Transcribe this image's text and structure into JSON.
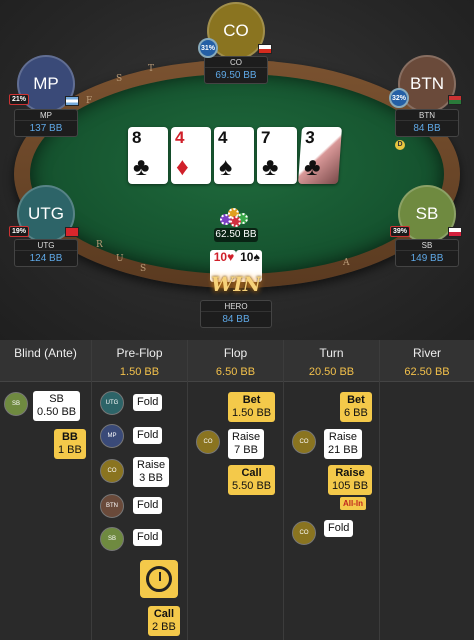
{
  "table": {
    "rail_text": [
      "F",
      "S",
      "T",
      "R",
      "U",
      "S",
      "A"
    ],
    "board": [
      {
        "rank": "8",
        "suit": "♣",
        "color": "black"
      },
      {
        "rank": "4",
        "suit": "♦",
        "color": "red"
      },
      {
        "rank": "4",
        "suit": "♠",
        "color": "black"
      },
      {
        "rank": "7",
        "suit": "♣",
        "color": "black"
      },
      {
        "rank": "3",
        "suit": "♣",
        "color": "black"
      }
    ],
    "pot": "62.50 BB",
    "dealer_label": "D"
  },
  "seats": {
    "co": {
      "label": "CO",
      "name": "CO",
      "stack": "69.50 BB",
      "pct": "31%",
      "color": "#8a7420"
    },
    "mp": {
      "label": "MP",
      "name": "MP",
      "stack": "137 BB",
      "pct": "21%",
      "color": "#3a4a78"
    },
    "btn": {
      "label": "BTN",
      "name": "BTN",
      "stack": "84 BB",
      "pct": "32%",
      "color": "#6a4a3a"
    },
    "utg": {
      "label": "UTG",
      "name": "UTG",
      "stack": "124 BB",
      "pct": "19%",
      "color": "#2d6468"
    },
    "sb": {
      "label": "SB",
      "name": "SB",
      "stack": "149 BB",
      "pct": "39%",
      "color": "#6f8a40"
    },
    "hero": {
      "name": "HERO",
      "stack": "84 BB",
      "cards": [
        "10♥",
        "10♠"
      ],
      "win_text": "WIN"
    }
  },
  "streets": [
    {
      "name": "Blind (Ante)",
      "pot": ""
    },
    {
      "name": "Pre-Flop",
      "pot": "1.50 BB"
    },
    {
      "name": "Flop",
      "pot": "6.50 BB"
    },
    {
      "name": "Turn",
      "pot": "20.50 BB"
    },
    {
      "name": "River",
      "pot": "62.50 BB"
    }
  ],
  "actions": {
    "blind_sb": {
      "pos": "SB",
      "label": "SB",
      "amount": "0.50 BB"
    },
    "blind_bb": {
      "label": "BB",
      "amount": "1 BB"
    },
    "pre_utg": {
      "pos": "UTG",
      "label": "Fold"
    },
    "pre_mp": {
      "pos": "MP",
      "label": "Fold"
    },
    "pre_co": {
      "pos": "CO",
      "label": "Raise",
      "amount": "3 BB"
    },
    "pre_btn": {
      "pos": "BTN",
      "label": "Fold"
    },
    "pre_sb": {
      "pos": "SB",
      "label": "Fold"
    },
    "pre_hero": {
      "label": "Call",
      "amount": "2 BB"
    },
    "flop_hero_bet": {
      "label": "Bet",
      "amount": "1.50 BB"
    },
    "flop_co": {
      "pos": "CO",
      "label": "Raise",
      "amount": "7 BB"
    },
    "flop_hero_call": {
      "label": "Call",
      "amount": "5.50 BB"
    },
    "turn_hero_bet": {
      "label": "Bet",
      "amount": "6 BB"
    },
    "turn_co": {
      "pos": "CO",
      "label": "Raise",
      "amount": "21 BB"
    },
    "turn_hero_raise": {
      "label": "Raise",
      "amount": "105 BB",
      "badge": "All-In"
    },
    "turn_co_fold": {
      "pos": "CO",
      "label": "Fold"
    }
  }
}
